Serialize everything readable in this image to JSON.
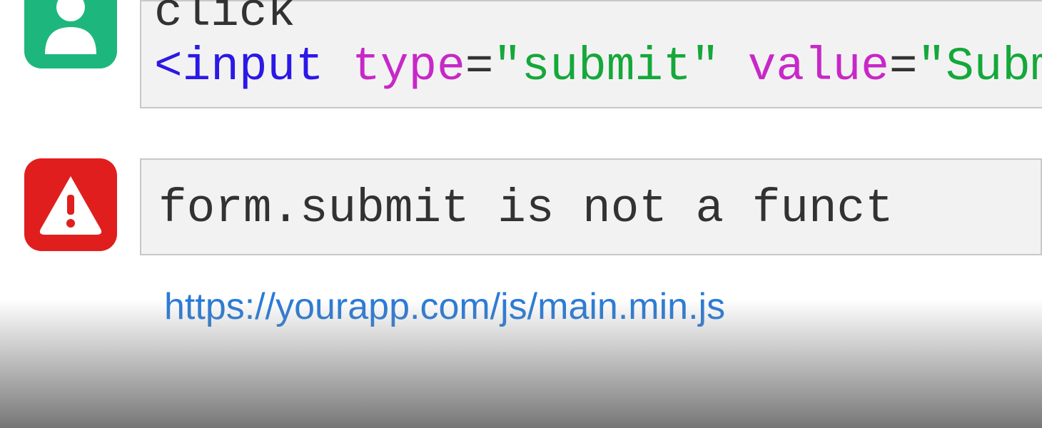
{
  "action": {
    "event": "click"
  },
  "code": {
    "tag_open": "<input",
    "attr_type_name": "type",
    "attr_type_value_q1": "\"",
    "attr_type_value": "submit",
    "attr_type_value_q2": "\"",
    "attr_value_name": "value",
    "attr_value_value_q1": "\"",
    "attr_value_value_partial": "Subm"
  },
  "error": {
    "message": "form.submit is not a funct"
  },
  "source": {
    "url": "https://yourapp.com/js/main.min.js"
  }
}
